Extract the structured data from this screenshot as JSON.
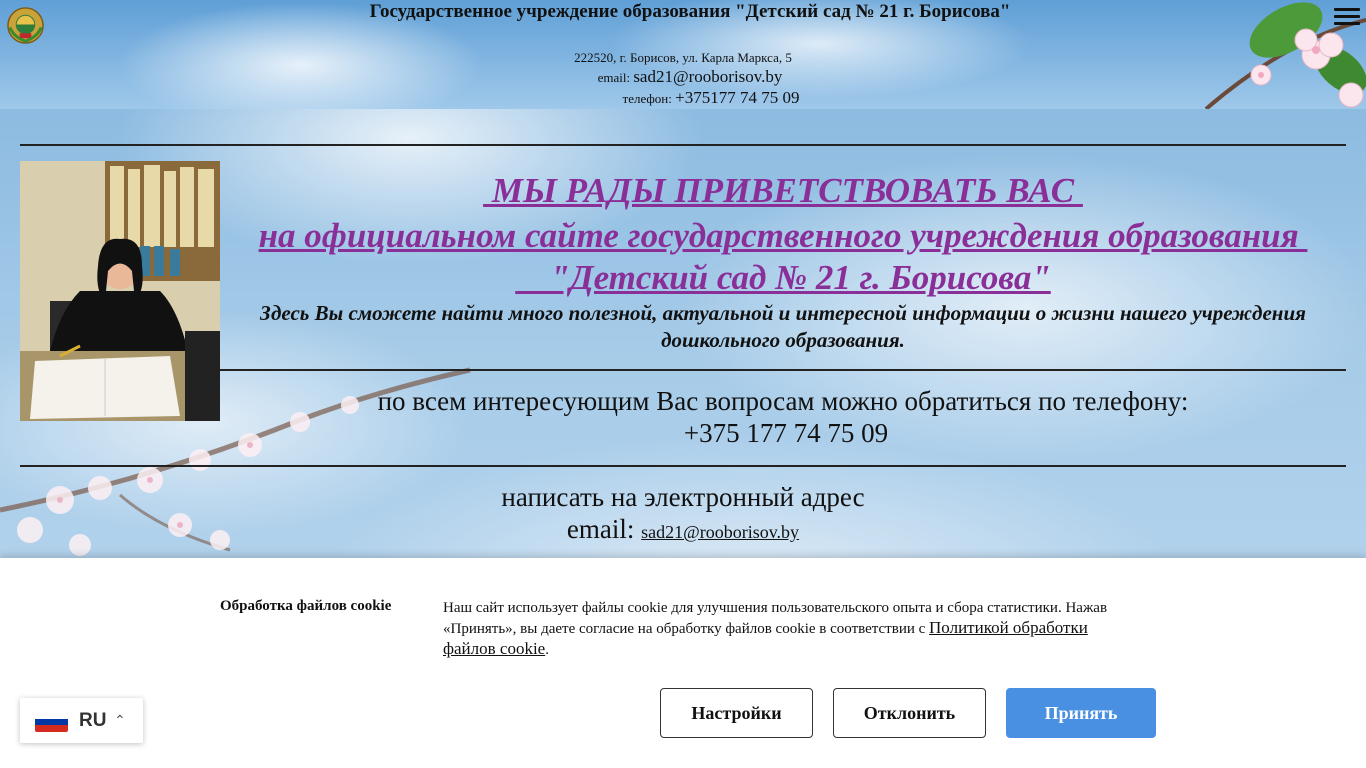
{
  "header": {
    "title": "Государственное учреждение образования \"Детский сад № 21 г. Борисова\"",
    "address": "222520, г. Борисов, ул. Карла Маркса, 5",
    "email_label": "email:",
    "email_value": "sad21@rooborisov.by",
    "phone_label": "телефон:",
    "phone_value": "+375177 74 75 09"
  },
  "main": {
    "welcome_line1": " МЫ РАДЫ ПРИВЕТСТВОВАТЬ ВАС ",
    "welcome_line2": "на официальном сайте государственного учреждения образования ",
    "welcome_line3": "    \"Детский сад № 21 г. Борисова\"",
    "intro": "Здесь  Вы сможете найти много полезной, актуальной и интересной информации о жизни нашего учреждения дошкольного образования.",
    "questions_line1": "по всем интересующим Вас вопросам можно обратиться по телефону:",
    "questions_phone": "+375 177 74 75 09",
    "email_line1": "написать на электронный адрес",
    "email_label": "email:",
    "email_link": "sad21@rooborisov.by"
  },
  "cookie": {
    "title": "Обработка файлов cookie",
    "text": "Наш сайт использует файлы cookie для улучшения пользовательского опыта и сбора статистики. Нажав «Принять», вы даете согласие на обработку файлов cookie в соответствии с ",
    "policy_link": "Политикой обработки файлов cookie",
    "text_end": ".",
    "settings_label": "Настройки",
    "decline_label": "Отклонить",
    "accept_label": "Принять",
    "accept_color": "#4a90e2"
  },
  "language": {
    "code": "RU",
    "flag_colors": [
      "#ffffff",
      "#0039a6",
      "#d52b1e"
    ]
  },
  "icons": {
    "menu": "hamburger-menu-icon",
    "emblem": "state-emblem-icon",
    "chevron": "chevron-up-icon"
  }
}
